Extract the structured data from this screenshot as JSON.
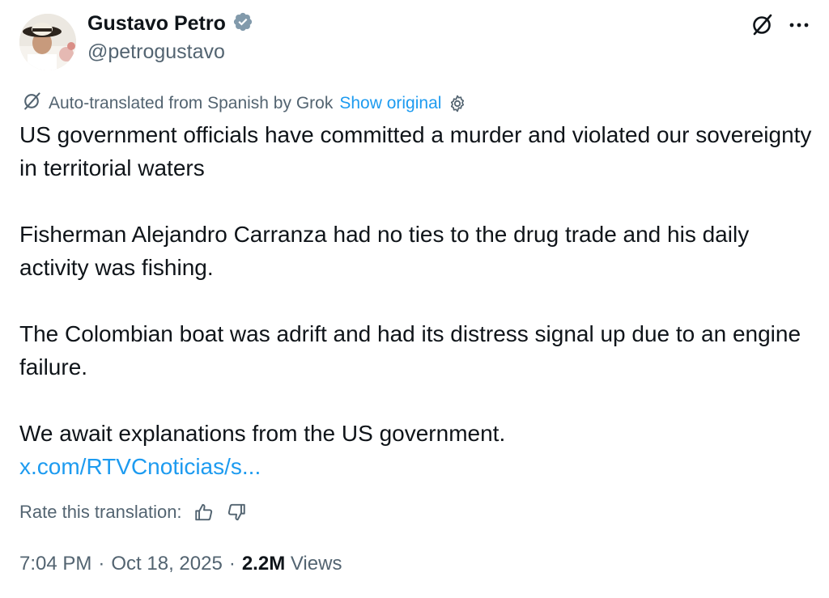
{
  "author": {
    "display_name": "Gustavo Petro",
    "handle": "@petrogustavo",
    "verified_badge_color": "#829aab"
  },
  "translation": {
    "notice": "Auto-translated from Spanish by Grok",
    "show_original": "Show original"
  },
  "tweet": {
    "paragraphs": [
      "US government officials have committed a murder and violated our sovereignty in territorial waters",
      "Fisherman Alejandro Carranza had no ties to the drug trade and his daily activity was fishing.",
      "The Colombian boat was adrift and had its distress signal up due to an engine failure.",
      "We await explanations from the US government."
    ],
    "link": "x.com/RTVCnoticias/s..."
  },
  "rate": {
    "label": "Rate this translation:"
  },
  "meta": {
    "time": "7:04 PM",
    "sep1": "·",
    "date": "Oct 18, 2025",
    "sep2": "·",
    "views_count": "2.2M",
    "views_label": "Views"
  },
  "icons": {
    "grok": "grok-icon",
    "more": "more-icon",
    "verified": "verified-badge-icon",
    "settings": "gear-icon",
    "thumbs_up": "thumbs-up-icon",
    "thumbs_down": "thumbs-down-icon"
  },
  "colors": {
    "link": "#1d9bf0",
    "secondary_text": "#536471",
    "primary_text": "#0f1419"
  }
}
